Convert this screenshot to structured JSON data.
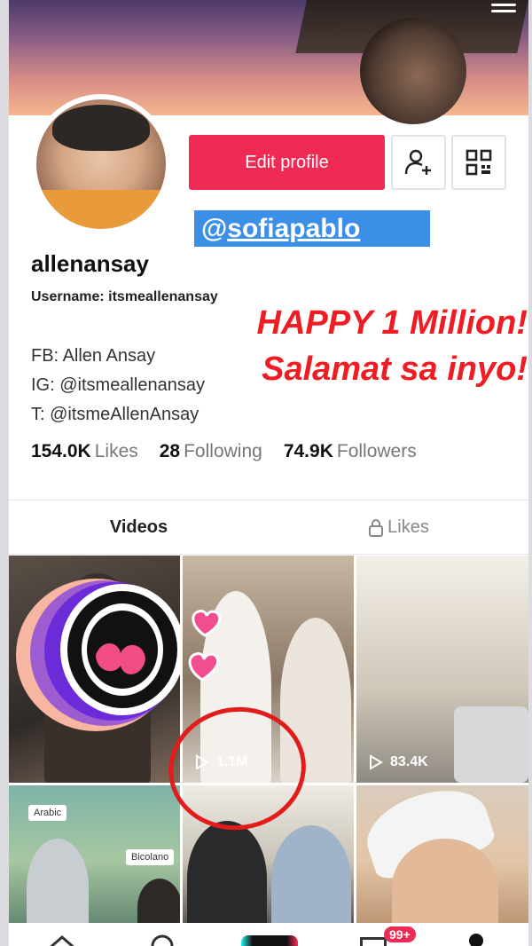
{
  "profile": {
    "display_name": "allenansay",
    "username_line": "Username: itsmeallenansay",
    "edit_button": "Edit profile",
    "bio": [
      "FB: Allen Ansay",
      "IG: @itsmeallenansay",
      "T: @itsmeAllenAnsay"
    ],
    "stats": [
      {
        "value": "154.0K",
        "label": "Likes"
      },
      {
        "value": "28",
        "label": "Following"
      },
      {
        "value": "74.9K",
        "label": "Followers"
      }
    ]
  },
  "overlay": {
    "mention_prefix": "@",
    "mention": "sofiapablo",
    "message_line1": "HAPPY 1 Million!",
    "message_line2": "Salamat sa inyo!"
  },
  "tabs": {
    "videos": "Videos",
    "likes": "Likes"
  },
  "videos": [
    {
      "views": ""
    },
    {
      "views": "1.1M"
    },
    {
      "views": "83.4K"
    },
    {
      "views": "",
      "tags": [
        "Arabic",
        "Bicolano"
      ]
    },
    {
      "views": ""
    },
    {
      "views": ""
    }
  ],
  "nav": {
    "inbox_badge": "99+"
  },
  "colors": {
    "accent": "#ee2a55",
    "mention_bg": "#3b8fe6",
    "message": "#ee1d23"
  }
}
